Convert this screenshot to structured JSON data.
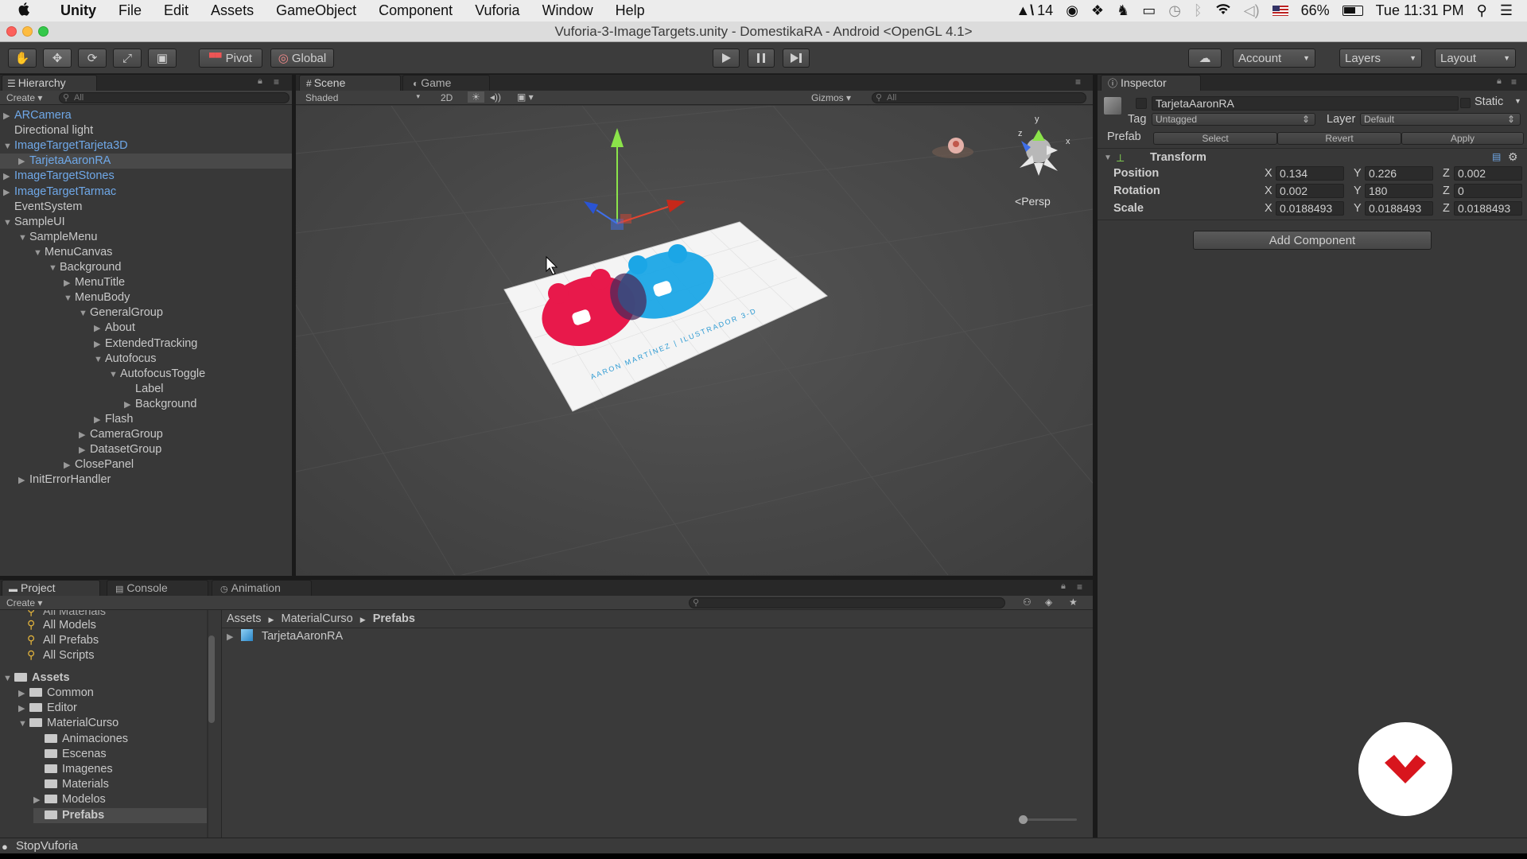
{
  "menubar": {
    "app": "Unity",
    "items": [
      "File",
      "Edit",
      "Assets",
      "GameObject",
      "Component",
      "Vuforia",
      "Window",
      "Help"
    ],
    "adobe_badge": "14",
    "battery": "66%",
    "clock": "Tue 11:31 PM"
  },
  "window": {
    "title": "Vuforia-3-ImageTargets.unity - DomestikaRA - Android <OpenGL 4.1>"
  },
  "toolbar": {
    "pivot_label": "Pivot",
    "global_label": "Global",
    "account_label": "Account",
    "layers_label": "Layers",
    "layout_label": "Layout"
  },
  "hierarchy": {
    "tab": "Hierarchy",
    "create": "Create",
    "search_placeholder": "All",
    "rows": [
      {
        "label": "ARCamera",
        "indent": 0,
        "arrow": "▶",
        "blue": true
      },
      {
        "label": "Directional light",
        "indent": 0,
        "arrow": "",
        "blue": false
      },
      {
        "label": "ImageTargetTarjeta3D",
        "indent": 0,
        "arrow": "▼",
        "blue": true
      },
      {
        "label": "TarjetaAaronRA",
        "indent": 1,
        "arrow": "▶",
        "blue": true,
        "selected": true
      },
      {
        "label": "ImageTargetStones",
        "indent": 0,
        "arrow": "▶",
        "blue": true
      },
      {
        "label": "ImageTargetTarmac",
        "indent": 0,
        "arrow": "▶",
        "blue": true
      },
      {
        "label": "EventSystem",
        "indent": 0,
        "arrow": "",
        "blue": false
      },
      {
        "label": "SampleUI",
        "indent": 0,
        "arrow": "▼",
        "blue": false
      },
      {
        "label": "SampleMenu",
        "indent": 1,
        "arrow": "▼",
        "blue": false
      },
      {
        "label": "MenuCanvas",
        "indent": 2,
        "arrow": "▼",
        "blue": false
      },
      {
        "label": "Background",
        "indent": 3,
        "arrow": "▼",
        "blue": false
      },
      {
        "label": "MenuTitle",
        "indent": 4,
        "arrow": "▶",
        "blue": false
      },
      {
        "label": "MenuBody",
        "indent": 4,
        "arrow": "▼",
        "blue": false
      },
      {
        "label": "GeneralGroup",
        "indent": 5,
        "arrow": "▼",
        "blue": false
      },
      {
        "label": "About",
        "indent": 6,
        "arrow": "▶",
        "blue": false
      },
      {
        "label": "ExtendedTracking",
        "indent": 6,
        "arrow": "▶",
        "blue": false
      },
      {
        "label": "Autofocus",
        "indent": 6,
        "arrow": "▼",
        "blue": false
      },
      {
        "label": "AutofocusToggle",
        "indent": 7,
        "arrow": "▼",
        "blue": false
      },
      {
        "label": "Label",
        "indent": 8,
        "arrow": "",
        "blue": false
      },
      {
        "label": "Background",
        "indent": 8,
        "arrow": "▶",
        "blue": false
      },
      {
        "label": "Flash",
        "indent": 6,
        "arrow": "▶",
        "blue": false
      },
      {
        "label": "CameraGroup",
        "indent": 5,
        "arrow": "▶",
        "blue": false
      },
      {
        "label": "DatasetGroup",
        "indent": 5,
        "arrow": "▶",
        "blue": false
      },
      {
        "label": "ClosePanel",
        "indent": 4,
        "arrow": "▶",
        "blue": false
      },
      {
        "label": "InitErrorHandler",
        "indent": 1,
        "arrow": "▶",
        "blue": false
      }
    ]
  },
  "scene": {
    "tab_scene": "Scene",
    "tab_game": "Game",
    "shading": "Shaded",
    "mode_2d": "2D",
    "gizmos": "Gizmos",
    "search_placeholder": "All",
    "persp_label": "Persp",
    "card_text": "AARON MARTÍNEZ | ILUSTRADOR 3-D"
  },
  "inspector": {
    "tab": "Inspector",
    "object_name": "TarjetaAaronRA",
    "static_label": "Static",
    "tag_label": "Tag",
    "tag_value": "Untagged",
    "layer_label": "Layer",
    "layer_value": "Default",
    "prefab_label": "Prefab",
    "prefab_select": "Select",
    "prefab_revert": "Revert",
    "prefab_apply": "Apply",
    "transform_label": "Transform",
    "position_label": "Position",
    "rotation_label": "Rotation",
    "scale_label": "Scale",
    "position": {
      "x": "0.134",
      "y": "0.226",
      "z": "0.002"
    },
    "rotation": {
      "x": "0.002",
      "y": "180",
      "z": "0"
    },
    "scale": {
      "x": "0.0188493",
      "y": "0.0188493",
      "z": "0.0188493"
    },
    "add_component": "Add Component"
  },
  "project": {
    "tab_project": "Project",
    "tab_console": "Console",
    "tab_animation": "Animation",
    "create": "Create",
    "favorites_cut": "All Materials",
    "favorites": [
      "All Models",
      "All Prefabs",
      "All Scripts"
    ],
    "assets_root": "Assets",
    "folders": [
      {
        "label": "Common",
        "indent": 1,
        "arrow": "▶"
      },
      {
        "label": "Editor",
        "indent": 1,
        "arrow": "▶"
      },
      {
        "label": "MaterialCurso",
        "indent": 1,
        "arrow": "▼"
      },
      {
        "label": "Animaciones",
        "indent": 2,
        "arrow": ""
      },
      {
        "label": "Escenas",
        "indent": 2,
        "arrow": ""
      },
      {
        "label": "Imagenes",
        "indent": 2,
        "arrow": ""
      },
      {
        "label": "Materials",
        "indent": 2,
        "arrow": ""
      },
      {
        "label": "Modelos",
        "indent": 2,
        "arrow": "▶"
      },
      {
        "label": "Prefabs",
        "indent": 2,
        "arrow": "",
        "selected": true
      }
    ],
    "breadcrumb": [
      "Assets",
      "MaterialCurso",
      "Prefabs"
    ],
    "file": "TarjetaAaronRA"
  },
  "status": {
    "text": "StopVuforia"
  },
  "colors": {
    "accent_blue": "#6fa8e8",
    "card_red": "#e8194b",
    "card_blue": "#1ba6e6",
    "domestika_red": "#d8151d"
  }
}
